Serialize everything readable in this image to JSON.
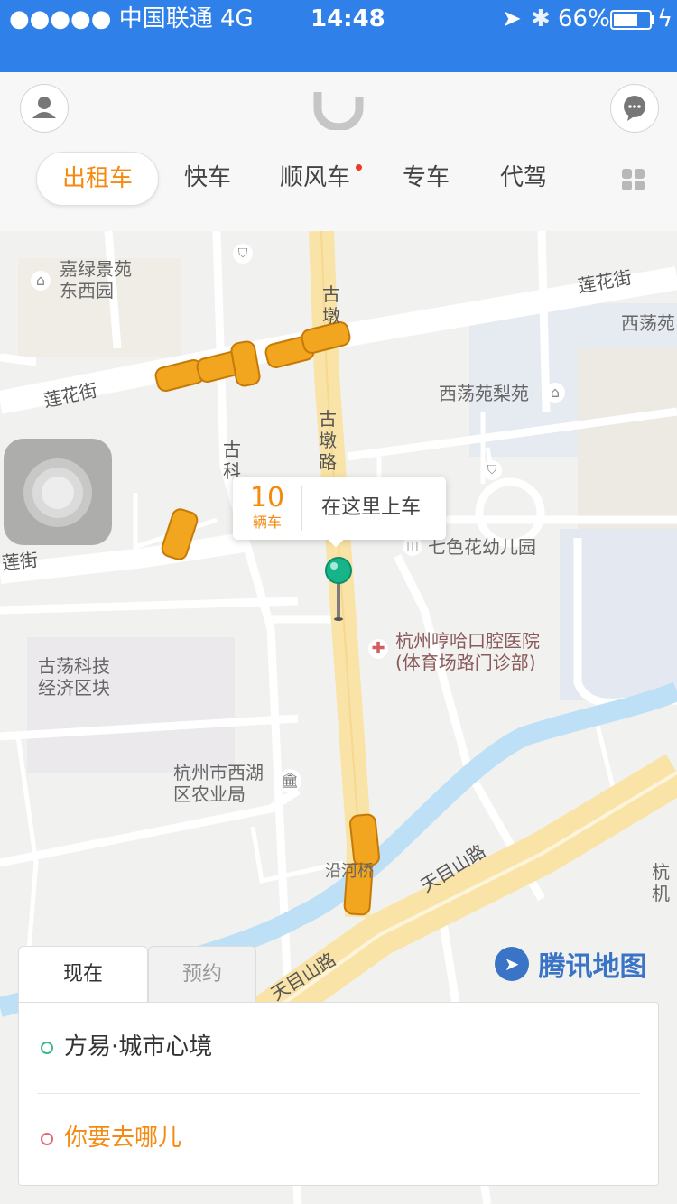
{
  "status_bar": {
    "carrier": "●●●●● 中国联通  4G",
    "time": "14:48",
    "battery": "66%"
  },
  "tabs": [
    {
      "label": "出租车",
      "active": true
    },
    {
      "label": "快车"
    },
    {
      "label": "顺风车",
      "badge": true
    },
    {
      "label": "专车"
    },
    {
      "label": "代驾"
    }
  ],
  "map": {
    "pickup_count": "10",
    "pickup_unit": "辆车",
    "pickup_action": "在这里上车",
    "labels": {
      "jialv": "嘉绿景苑\n东西园",
      "lianhua_e": "莲花街",
      "xidang_top": "西荡苑",
      "xidang_lieyuan": "西荡苑梨苑",
      "lianhua_w": "莲花街",
      "lianhua_w2": "莲街",
      "gudun_n": "古墩",
      "gudun_road": "古墩路",
      "guke": "古科",
      "qisehua": "七色花幼儿园",
      "hospital": "杭州哼哈口腔医院\n(体育场路门诊部)",
      "gudang": "古荡科技\n经济区块",
      "nongye": "杭州市西湖\n区农业局",
      "yanhe": "沿河桥",
      "tianmu1": "天目山路",
      "tianmu2": "天目山路",
      "hang_edge": "杭\n机"
    },
    "brand": "腾讯地图"
  },
  "panel": {
    "tab_now": "现在",
    "tab_reserve": "预约",
    "origin": "方易·城市心境",
    "destination": "你要去哪儿"
  },
  "colors": {
    "accent": "#f58a10",
    "statusbar": "#2f80e8",
    "origin_dot": "#3fb98a",
    "dest_dot": "#e06a78"
  }
}
